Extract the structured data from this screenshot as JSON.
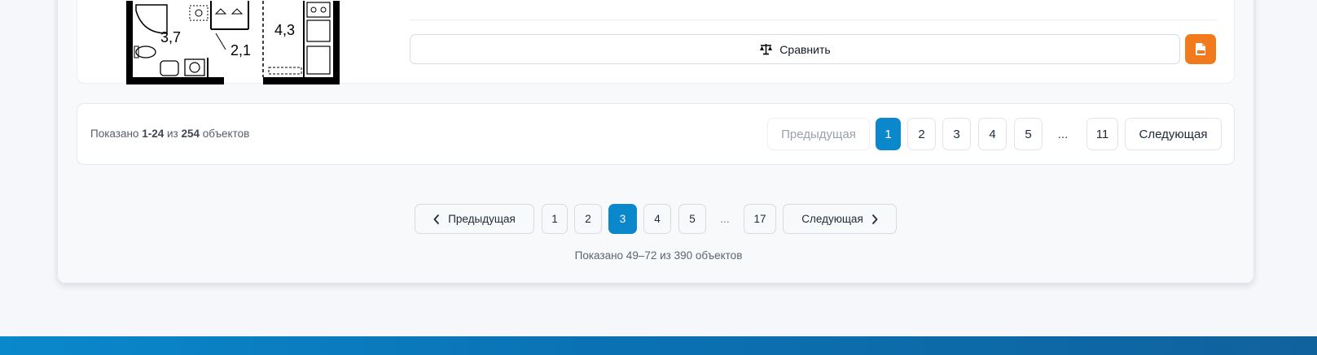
{
  "listing": {
    "floorplan": {
      "room_area_1": "3,7",
      "room_area_2": "2,1",
      "room_area_3": "4,3"
    },
    "compare_label": "Сравнить",
    "pdf_icon": "pdf-file-icon",
    "compare_icon": "scales-icon"
  },
  "pagination_top": {
    "shown_prefix": "Показано",
    "shown_range": "1-24",
    "shown_of": "из",
    "shown_total": "254",
    "shown_suffix": "объектов",
    "prev_label": "Предыдущая",
    "pages": [
      "1",
      "2",
      "3",
      "4",
      "5"
    ],
    "ellipsis": "...",
    "last_page": "11",
    "next_label": "Следующая",
    "active_page": "1"
  },
  "pagination_bottom": {
    "prev_label": "Предыдущая",
    "pages": [
      "1",
      "2",
      "3",
      "4",
      "5"
    ],
    "ellipsis": "...",
    "last_page": "17",
    "next_label": "Следующая",
    "active_page": "3",
    "shown_text": "Показано 49–72 из 390 объектов"
  },
  "colors": {
    "accent": "#0b87cc",
    "pdf_button": "#f07a1c",
    "footer": "#0a72b4"
  }
}
